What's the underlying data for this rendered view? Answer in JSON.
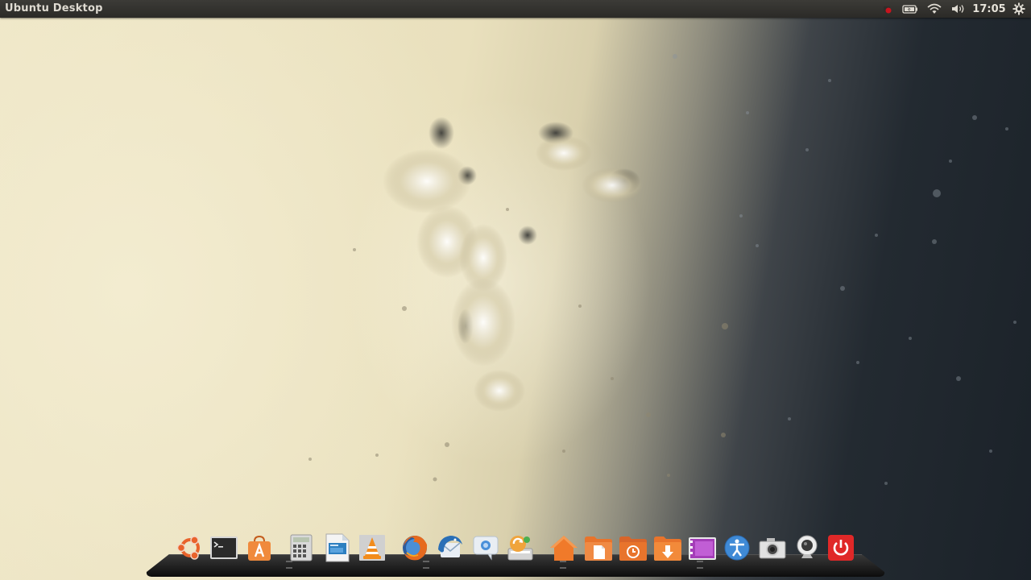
{
  "top_panel": {
    "window_title": "Ubuntu Desktop",
    "clock": "17:05",
    "indicators": [
      {
        "name": "recording-indicator-icon",
        "color": "#c8141e"
      },
      {
        "name": "battery-icon"
      },
      {
        "name": "wifi-icon"
      },
      {
        "name": "volume-icon"
      },
      {
        "name": "session-gear-icon"
      }
    ]
  },
  "dock": {
    "items": [
      {
        "name": "ubuntu-dash",
        "icon": "ubuntu-logo-icon",
        "color": "#e9632c"
      },
      {
        "name": "terminal",
        "icon": "terminal-icon",
        "color": "#2b2b2b"
      },
      {
        "name": "software-center",
        "icon": "software-center-icon",
        "color": "#f08a3c"
      },
      {
        "name": "calculator",
        "icon": "calculator-icon",
        "color": "#d9d9d9"
      },
      {
        "name": "libreoffice-impress",
        "icon": "presentation-doc-icon",
        "color": "#2d7fc0"
      },
      {
        "name": "vlc",
        "icon": "vlc-cone-icon",
        "color": "#f28c1c"
      },
      {
        "name": "firefox",
        "icon": "firefox-icon",
        "color": "#e66a1e"
      },
      {
        "name": "thunderbird",
        "icon": "thunderbird-icon",
        "color": "#2a6fb6"
      },
      {
        "name": "empathy-chat",
        "icon": "chat-bubble-icon",
        "color": "#4a90d9"
      },
      {
        "name": "update-manager",
        "icon": "update-manager-icon",
        "color": "#f0a43c"
      },
      {
        "name": "home-folder",
        "icon": "home-folder-icon",
        "color": "#f07a2a"
      },
      {
        "name": "documents-folder",
        "icon": "documents-folder-icon",
        "color": "#f08a44"
      },
      {
        "name": "recent-folder",
        "icon": "recent-folder-icon",
        "color": "#e8742c"
      },
      {
        "name": "downloads-folder",
        "icon": "downloads-folder-icon",
        "color": "#f28a3a"
      },
      {
        "name": "videos-folder",
        "icon": "video-folder-icon",
        "color": "#a43db8"
      },
      {
        "name": "accessibility",
        "icon": "accessibility-icon",
        "color": "#3f8ad6"
      },
      {
        "name": "screenshot",
        "icon": "camera-icon",
        "color": "#cfcfcf"
      },
      {
        "name": "webcam",
        "icon": "webcam-icon",
        "color": "#e0e0e0"
      },
      {
        "name": "shutdown",
        "icon": "power-icon",
        "color": "#e02828"
      }
    ]
  }
}
